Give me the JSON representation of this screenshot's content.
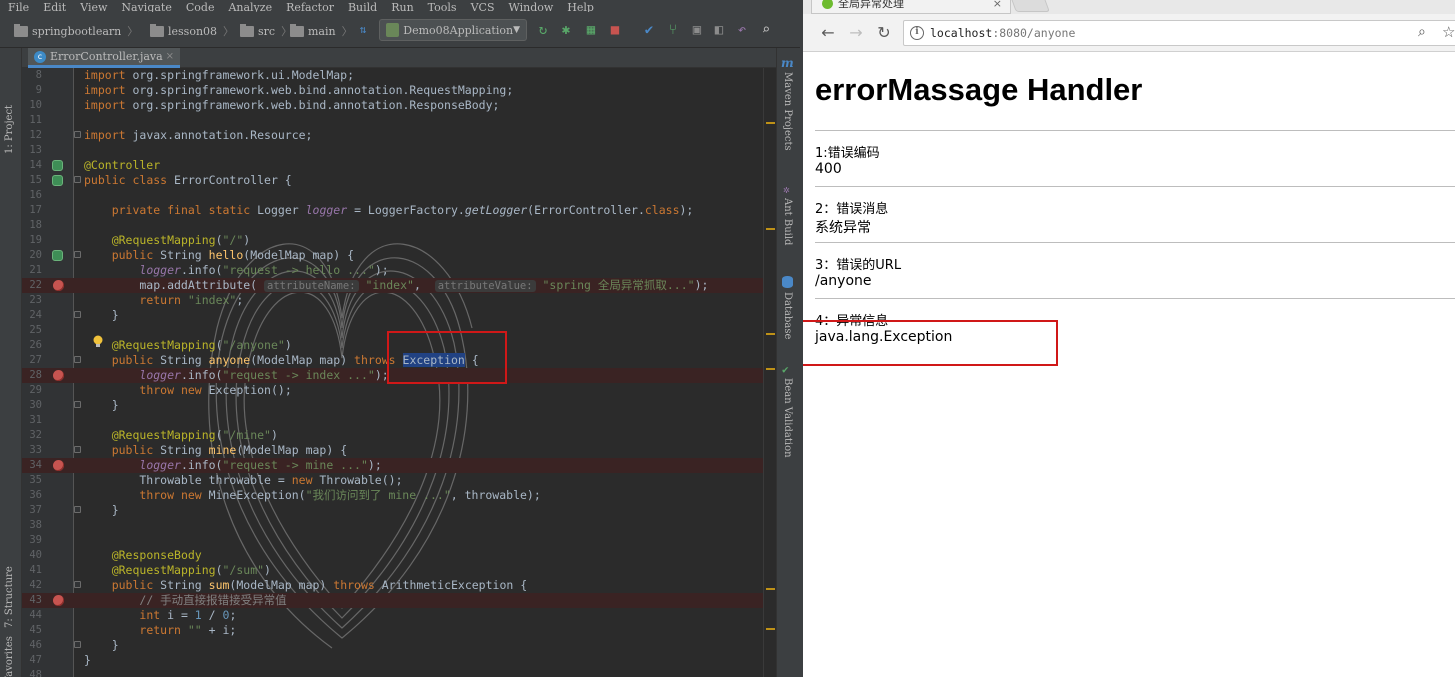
{
  "ide": {
    "menu": [
      "File",
      "Edit",
      "View",
      "Navigate",
      "Code",
      "Analyze",
      "Refactor",
      "Build",
      "Run",
      "Tools",
      "VCS",
      "Window",
      "Help"
    ],
    "breadcrumbs": [
      "springbootlearn",
      "lesson08",
      "src",
      "main"
    ],
    "run_config": "Demo08Application",
    "left_tools": {
      "project": "1: Project",
      "structure": "7: Structure",
      "favorites": "Favorites"
    },
    "right_tools": {
      "maven": "Maven Projects",
      "ant": "Ant Build",
      "database": "Database",
      "bean": "Bean Validation"
    },
    "tab": {
      "label": "ErrorController.java",
      "icon": "class-icon"
    },
    "code": [
      {
        "n": "8",
        "t": "import org.springframework.ui.ModelMap;"
      },
      {
        "n": "9",
        "t": "import org.springframework.web.bind.annotation.RequestMapping;"
      },
      {
        "n": "10",
        "t": "import org.springframework.web.bind.annotation.ResponseBody;"
      },
      {
        "n": "11",
        "t": ""
      },
      {
        "n": "12",
        "t": "import javax.annotation.Resource;"
      },
      {
        "n": "13",
        "t": ""
      },
      {
        "n": "14",
        "t": "@Controller"
      },
      {
        "n": "15",
        "t": "public class ErrorController {"
      },
      {
        "n": "16",
        "t": ""
      },
      {
        "n": "17",
        "t": "    private final static Logger logger = LoggerFactory.getLogger(ErrorController.class);"
      },
      {
        "n": "18",
        "t": ""
      },
      {
        "n": "19",
        "t": "    @RequestMapping(\"/\")"
      },
      {
        "n": "20",
        "t": "    public String hello(ModelMap map) {"
      },
      {
        "n": "21",
        "t": "        logger.info(\"request -> hello ...\");"
      },
      {
        "n": "22",
        "t": "        map.addAttribute( attributeName: \"index\",  attributeValue: \"spring 全局异常抓取...\");"
      },
      {
        "n": "23",
        "t": "        return \"index\";"
      },
      {
        "n": "24",
        "t": "    }"
      },
      {
        "n": "25",
        "t": ""
      },
      {
        "n": "26",
        "t": "    @RequestMapping(\"/anyone\")"
      },
      {
        "n": "27",
        "t": "    public String anyone(ModelMap map) throws Exception {"
      },
      {
        "n": "28",
        "t": "        logger.info(\"request -> index ...\");"
      },
      {
        "n": "29",
        "t": "        throw new Exception();"
      },
      {
        "n": "30",
        "t": "    }"
      },
      {
        "n": "31",
        "t": ""
      },
      {
        "n": "32",
        "t": "    @RequestMapping(\"/mine\")"
      },
      {
        "n": "33",
        "t": "    public String mine(ModelMap map) {"
      },
      {
        "n": "34",
        "t": "        logger.info(\"request -> mine ...\");"
      },
      {
        "n": "35",
        "t": "        Throwable throwable = new Throwable();"
      },
      {
        "n": "36",
        "t": "        throw new MineException(\"我们访问到了 mine ...\", throwable);"
      },
      {
        "n": "37",
        "t": "    }"
      },
      {
        "n": "38",
        "t": ""
      },
      {
        "n": "39",
        "t": ""
      },
      {
        "n": "40",
        "t": "    @ResponseBody"
      },
      {
        "n": "41",
        "t": "    @RequestMapping(\"/sum\")"
      },
      {
        "n": "42",
        "t": "    public String sum(ModelMap map) throws ArithmeticException {"
      },
      {
        "n": "43",
        "t": "        // 手动直接报错接受异常值"
      },
      {
        "n": "44",
        "t": "        int i = 1 / 0;"
      },
      {
        "n": "45",
        "t": "        return \"\" + i;"
      },
      {
        "n": "46",
        "t": "    }"
      },
      {
        "n": "47",
        "t": "}"
      },
      {
        "n": "48",
        "t": ""
      }
    ],
    "breakpoint_lines": [
      "22",
      "28",
      "34",
      "43"
    ],
    "bean_lines": [
      "14",
      "15",
      "20"
    ]
  },
  "browser": {
    "tab_title": "全局异常处理",
    "url_host": "localhost",
    "url_rest": ":8080/anyone",
    "heading": "errorMassage Handler",
    "items": [
      {
        "label": "1:错误编码",
        "value": "400"
      },
      {
        "label": "2：错误消息",
        "value": "系统异常"
      },
      {
        "label": "3：错误的URL",
        "value": "/anyone"
      },
      {
        "label": "4：异常信息",
        "value": "java.lang.Exception"
      }
    ]
  },
  "colors": {
    "ide_bg": "#2b2b2b",
    "keyword": "#cc7832",
    "string": "#6a8759",
    "annotation": "#bbb529",
    "highlight_box": "#d01818"
  }
}
